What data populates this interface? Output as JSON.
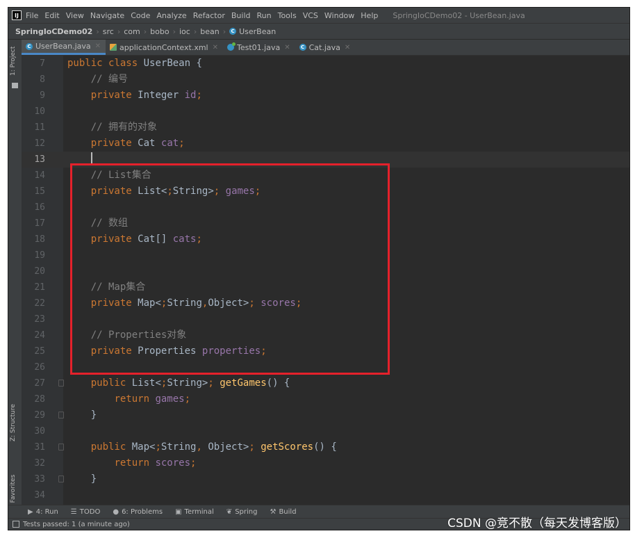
{
  "menubar": {
    "items": [
      "File",
      "Edit",
      "View",
      "Navigate",
      "Code",
      "Analyze",
      "Refactor",
      "Build",
      "Run",
      "Tools",
      "VCS",
      "Window",
      "Help"
    ],
    "window_title": "SpringIoCDemo02 - UserBean.java"
  },
  "breadcrumb": {
    "project": "SpringIoCDemo02",
    "segments": [
      "src",
      "com",
      "bobo",
      "ioc",
      "bean"
    ],
    "current": "UserBean"
  },
  "tool_windows": {
    "project": "1: Project",
    "structure": "Z: Structure",
    "favorites": "2: Favorites"
  },
  "tabs": [
    {
      "label": "UserBean.java",
      "icon": "class-icon",
      "active": true
    },
    {
      "label": "applicationContext.xml",
      "icon": "xml-file-icon",
      "active": false
    },
    {
      "label": "Test01.java",
      "icon": "test-class-icon",
      "active": false
    },
    {
      "label": "Cat.java",
      "icon": "class-icon",
      "active": false
    }
  ],
  "editor": {
    "current_line": 13,
    "lines": [
      {
        "n": "7",
        "text": "public class UserBean {"
      },
      {
        "n": "8",
        "text": "    // 编号"
      },
      {
        "n": "9",
        "text": "    private Integer id;"
      },
      {
        "n": "10",
        "text": ""
      },
      {
        "n": "11",
        "text": "    // 拥有的对象"
      },
      {
        "n": "12",
        "text": "    private Cat cat;"
      },
      {
        "n": "13",
        "text": ""
      },
      {
        "n": "14",
        "text": "    // List集合"
      },
      {
        "n": "15",
        "text": "    private List<String> games;"
      },
      {
        "n": "16",
        "text": ""
      },
      {
        "n": "17",
        "text": "    // 数组"
      },
      {
        "n": "18",
        "text": "    private Cat[] cats;"
      },
      {
        "n": "19",
        "text": ""
      },
      {
        "n": "20",
        "text": ""
      },
      {
        "n": "21",
        "text": "    // Map集合"
      },
      {
        "n": "22",
        "text": "    private Map<String,Object> scores;"
      },
      {
        "n": "23",
        "text": ""
      },
      {
        "n": "24",
        "text": "    // Properties对象"
      },
      {
        "n": "25",
        "text": "    private Properties properties;"
      },
      {
        "n": "26",
        "text": ""
      },
      {
        "n": "27",
        "text": "    public List<String> getGames() {"
      },
      {
        "n": "28",
        "text": "        return games;"
      },
      {
        "n": "29",
        "text": "    }"
      },
      {
        "n": "30",
        "text": ""
      },
      {
        "n": "31",
        "text": "    public Map<String, Object> getScores() {"
      },
      {
        "n": "32",
        "text": "        return scores;"
      },
      {
        "n": "33",
        "text": "    }"
      },
      {
        "n": "34",
        "text": ""
      }
    ]
  },
  "bottom_toolbar": [
    {
      "label": "4: Run",
      "icon": "run-icon"
    },
    {
      "label": "TODO",
      "icon": "todo-icon"
    },
    {
      "label": "6: Problems",
      "icon": "problems-icon"
    },
    {
      "label": "Terminal",
      "icon": "terminal-icon"
    },
    {
      "label": "Spring",
      "icon": "spring-icon"
    },
    {
      "label": "Build",
      "icon": "build-icon"
    }
  ],
  "status": {
    "message": "Tests passed: 1 (a minute ago)"
  },
  "watermark": "CSDN @竞不散（每天发博客版）",
  "colors": {
    "highlight_box": "#e5212b",
    "keyword": "#cc7832",
    "comment": "#808080",
    "field": "#9876aa",
    "method": "#ffc66d"
  }
}
